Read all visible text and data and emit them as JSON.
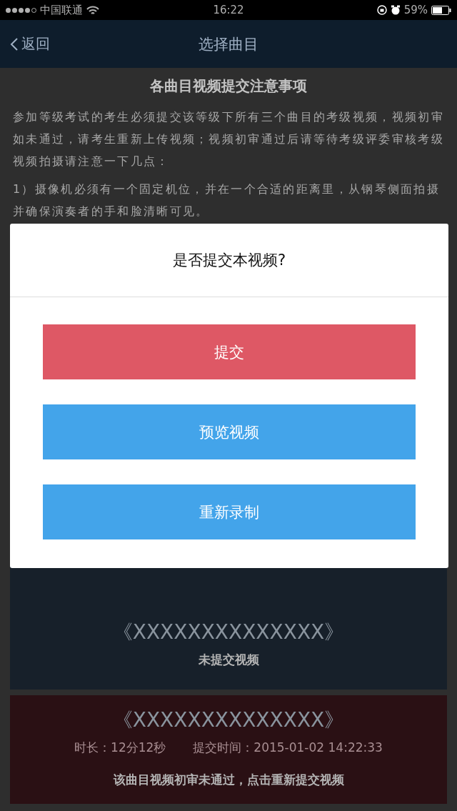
{
  "status_bar": {
    "carrier": "中国联通",
    "time": "16:22",
    "battery": "59%"
  },
  "nav_bar": {
    "back": "返回",
    "title": "选择曲目"
  },
  "notice": {
    "title": "各曲目视频提交注意事项",
    "paragraphs": [
      "参加等级考试的考生必须提交该等级下所有三个曲目的考级视频，视频初审如未通过，请考生重新上传视频；视频初审通过后请等待考级评委审核考级视频拍摄请注意一下几点：",
      "1）摄像机必须有一个固定机位，并在一个合适的距离里，从钢琴侧面拍摄并确保演奏者的手和脸清晰可见。"
    ]
  },
  "dialog": {
    "title": "是否提交本视频?",
    "buttons": [
      {
        "label": "提交",
        "kind": "danger"
      },
      {
        "label": "预览视频",
        "kind": "primary"
      },
      {
        "label": "重新录制",
        "kind": "primary"
      }
    ]
  },
  "songs": [
    {
      "kind": "pending",
      "title": "《XXXXXXXXXXXXXX》",
      "status": "未提交视频"
    },
    {
      "kind": "rejected",
      "title": "《XXXXXXXXXXXXXX》",
      "duration": "时长：12分12秒",
      "submitted": "提交时间：2015-01-02 14:22:33",
      "status": "该曲目视频初审未通过，点击重新提交视频"
    }
  ]
}
